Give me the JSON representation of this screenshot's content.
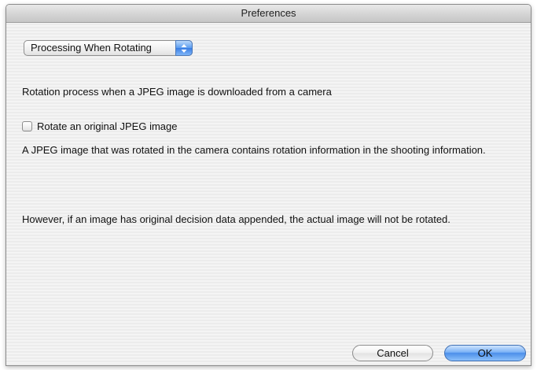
{
  "window": {
    "title": "Preferences"
  },
  "popup": {
    "selected": "Processing When Rotating",
    "icon": "updown-arrows-icon"
  },
  "content": {
    "heading": "Rotation process when a JPEG image is downloaded from a camera",
    "checkbox_label": "Rotate an original JPEG image",
    "checkbox_checked": false,
    "info1": "A JPEG image that was rotated in the camera contains rotation information in the shooting information.",
    "info2": "However, if an image has original decision data appended, the actual image will not be rotated."
  },
  "buttons": {
    "cancel": "Cancel",
    "ok": "OK"
  },
  "colors": {
    "accent": "#5b9cf0"
  }
}
